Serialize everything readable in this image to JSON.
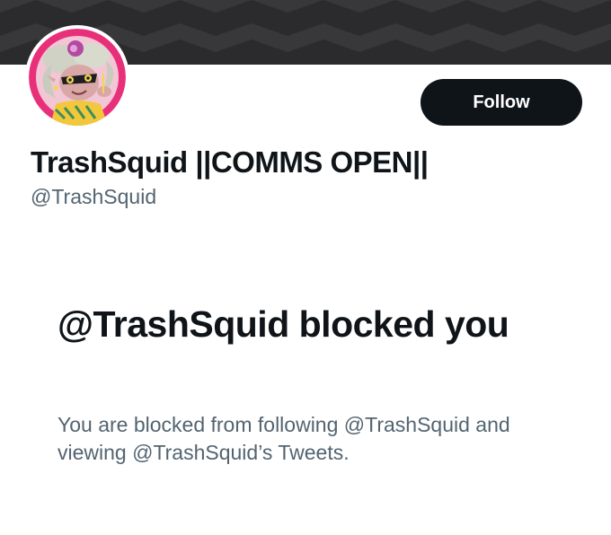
{
  "profile": {
    "display_name": "TrashSquid ||COMMS OPEN||",
    "handle": "@TrashSquid",
    "follow_label": "Follow",
    "avatar_icon": "avatar-illustration"
  },
  "blocked": {
    "title": "@TrashSquid blocked you",
    "description": "You are blocked from following @TrashSquid and viewing @TrashSquid’s Tweets."
  },
  "colors": {
    "banner": "#3a3a3c",
    "avatar_ring": "#e8307a",
    "button_bg": "#0f1419",
    "text_primary": "#0f1419",
    "text_secondary": "#536471"
  }
}
